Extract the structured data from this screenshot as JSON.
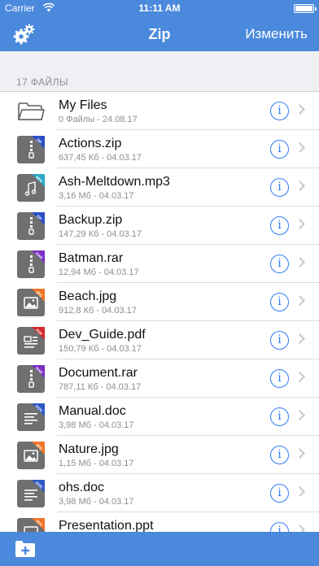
{
  "status_bar": {
    "carrier": "Carrier",
    "time": "11:11 AM"
  },
  "nav": {
    "title": "Zip",
    "edit_label": "Изменить",
    "settings_icon": "gears-icon"
  },
  "section": {
    "header": "17 ФАЙЛЫ"
  },
  "files": [
    {
      "name": "My Files",
      "meta": "0 Файлы - 24.08.17",
      "type": "folder"
    },
    {
      "name": "Actions.zip",
      "meta": "637,45 Кб - 04.03.17",
      "type": "zip",
      "badge": "ZIP",
      "badge_color": "#2d4fc4"
    },
    {
      "name": "Ash-Meltdown.mp3",
      "meta": "3,16 Мб - 04.03.17",
      "type": "mp3",
      "badge": "MP3",
      "badge_color": "#29a6c7"
    },
    {
      "name": "Backup.zip",
      "meta": "147,29 Кб - 04.03.17",
      "type": "zip",
      "badge": "ZIP",
      "badge_color": "#2d4fc4"
    },
    {
      "name": "Batman.rar",
      "meta": "12,94 Мб - 04.03.17",
      "type": "rar",
      "badge": "RAR",
      "badge_color": "#7b2ec2"
    },
    {
      "name": "Beach.jpg",
      "meta": "912,8 Кб - 04.03.17",
      "type": "jpg",
      "badge": "JPG",
      "badge_color": "#f0762a"
    },
    {
      "name": "Dev_Guide.pdf",
      "meta": "150,79 Кб - 04.03.17",
      "type": "pdf",
      "badge": "PDF",
      "badge_color": "#d4272b"
    },
    {
      "name": "Document.rar",
      "meta": "787,11 Кб - 04.03.17",
      "type": "rar",
      "badge": "RAR",
      "badge_color": "#7b2ec2"
    },
    {
      "name": "Manual.doc",
      "meta": "3,98 Мб - 04.03.17",
      "type": "doc",
      "badge": "DOC",
      "badge_color": "#2d58c7"
    },
    {
      "name": "Nature.jpg",
      "meta": "1,15 Мб - 04.03.17",
      "type": "jpg",
      "badge": "JPG",
      "badge_color": "#f0762a"
    },
    {
      "name": "ohs.doc",
      "meta": "3,98 Мб - 04.03.17",
      "type": "doc",
      "badge": "DOC",
      "badge_color": "#2d58c7"
    },
    {
      "name": "Presentation.ppt",
      "meta": "",
      "type": "ppt",
      "badge": "PPT",
      "badge_color": "#f0762a"
    }
  ],
  "bottom_bar": {
    "new_folder_icon": "new-folder-icon"
  },
  "colors": {
    "nav_bar": "#4a89dc",
    "info_accent": "#2f7cf6",
    "file_icon": "#6f6f6f"
  }
}
